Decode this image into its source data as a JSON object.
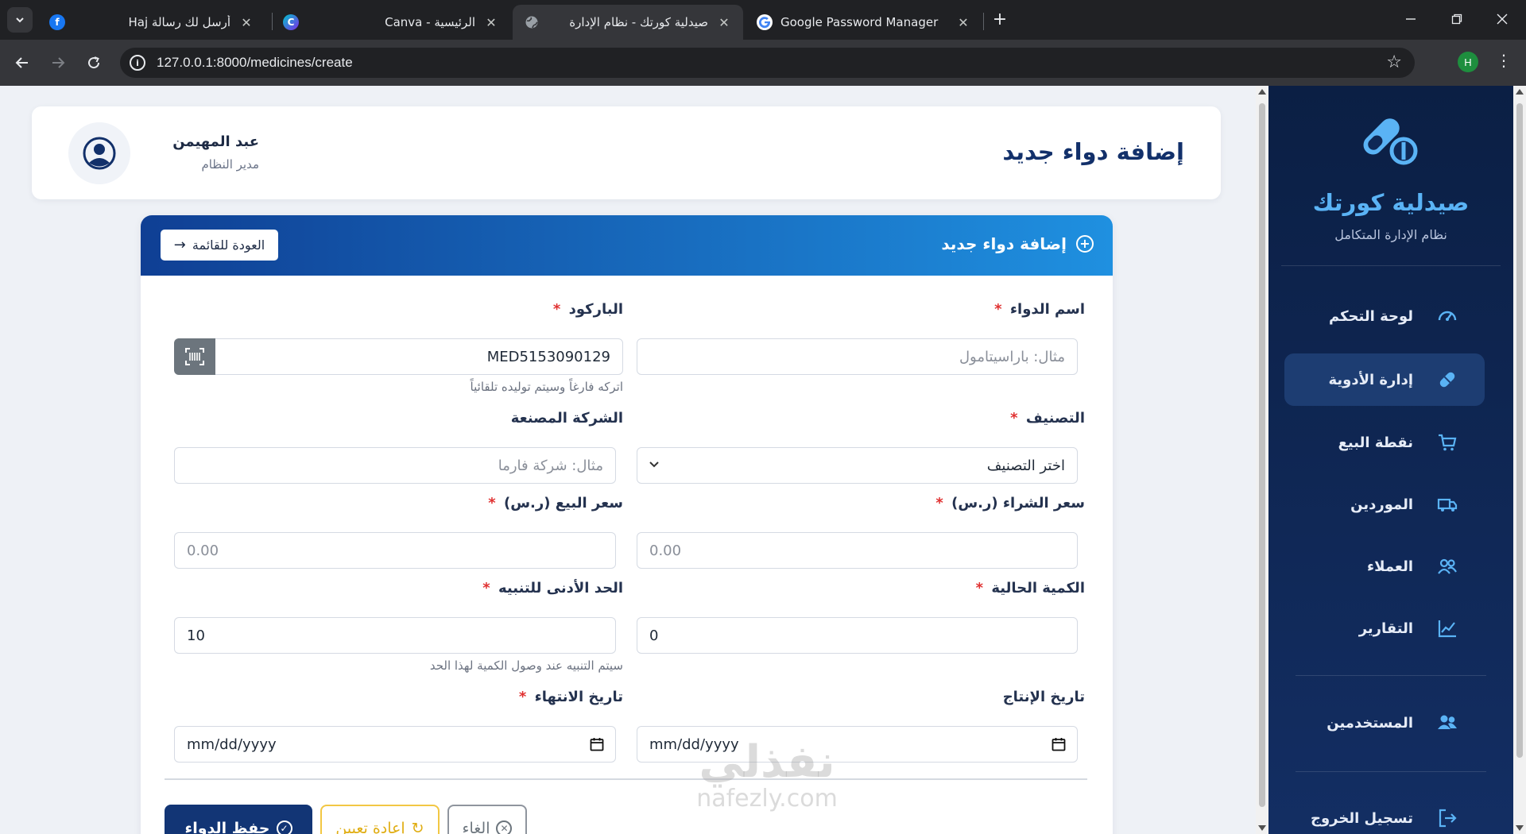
{
  "browser": {
    "tabs": [
      {
        "title": "أرسل لك رسالة Haj",
        "favicon": "facebook-icon",
        "active": false
      },
      {
        "title": "الرئيسية - Canva",
        "favicon": "canva-icon",
        "active": false
      },
      {
        "title": "صيدلية كورتك - نظام الإدارة",
        "favicon": "globe-icon",
        "active": true
      },
      {
        "title": "Google Password Manager",
        "favicon": "google-icon",
        "active": false
      }
    ],
    "url": "127.0.0.1:8000/medicines/create",
    "profile_initial": "H"
  },
  "sidebar": {
    "brand_name": "صيدلية كورتك",
    "brand_subtitle": "نظام الإدارة المتكامل",
    "items": [
      {
        "label": "لوحة التحكم",
        "icon": "dashboard-icon",
        "active": false
      },
      {
        "label": "إدارة الأدوية",
        "icon": "pill-icon",
        "active": true
      },
      {
        "label": "نقطة البيع",
        "icon": "cart-icon",
        "active": false
      },
      {
        "label": "الموردين",
        "icon": "truck-icon",
        "active": false
      },
      {
        "label": "العملاء",
        "icon": "customers-icon",
        "active": false
      },
      {
        "label": "التقارير",
        "icon": "chart-line-icon",
        "active": false
      },
      {
        "label": "المستخدمين",
        "icon": "users-icon",
        "active": false
      },
      {
        "label": "تسجيل الخروج",
        "icon": "logout-icon",
        "active": false
      }
    ]
  },
  "header": {
    "title": "إضافة دواء جديد",
    "user_name": "عبد المهيمن",
    "user_role": "مدير النظام"
  },
  "form": {
    "card_title": "إضافة دواء جديد",
    "back_label": "العودة للقائمة",
    "fields": {
      "name": {
        "label": "اسم الدواء",
        "placeholder": "مثال: باراسيتامول",
        "required": true
      },
      "barcode": {
        "label": "الباركود",
        "value": "MED5153090129",
        "hint": "اتركه فارغاً وسيتم توليده تلقائياً",
        "required": true
      },
      "category": {
        "label": "التصنيف",
        "selected": "اختر التصنيف",
        "required": true
      },
      "manufacturer": {
        "label": "الشركة المصنعة",
        "placeholder": "مثال: شركة فارما",
        "required": false
      },
      "purchase_price": {
        "label": "سعر الشراء (ر.س)",
        "value": "0.00",
        "required": true
      },
      "sale_price": {
        "label": "سعر البيع (ر.س)",
        "value": "0.00",
        "required": true
      },
      "quantity": {
        "label": "الكمية الحالية",
        "value": "0",
        "required": true
      },
      "min_alert": {
        "label": "الحد الأدنى للتنبيه",
        "value": "10",
        "hint": "سيتم التنبيه عند وصول الكمية لهذا الحد",
        "required": true
      },
      "production_date": {
        "label": "تاريخ الإنتاج",
        "placeholder": "mm/dd/yyyy",
        "required": false
      },
      "expiry_date": {
        "label": "تاريخ الانتهاء",
        "placeholder": "mm/dd/yyyy",
        "required": true
      }
    },
    "required_mark": "*",
    "buttons": {
      "save": "حفظ الدواء",
      "reset": "إعادة تعيين",
      "cancel": "إلغاء"
    }
  },
  "watermark": {
    "arabic": "نفذلي",
    "latin": "nafezly.com"
  },
  "colors": {
    "primary": "#123575",
    "accent": "#1f90e0",
    "sidebar": "#0b1f44",
    "danger": "#e03131",
    "warning": "#f2c744"
  }
}
